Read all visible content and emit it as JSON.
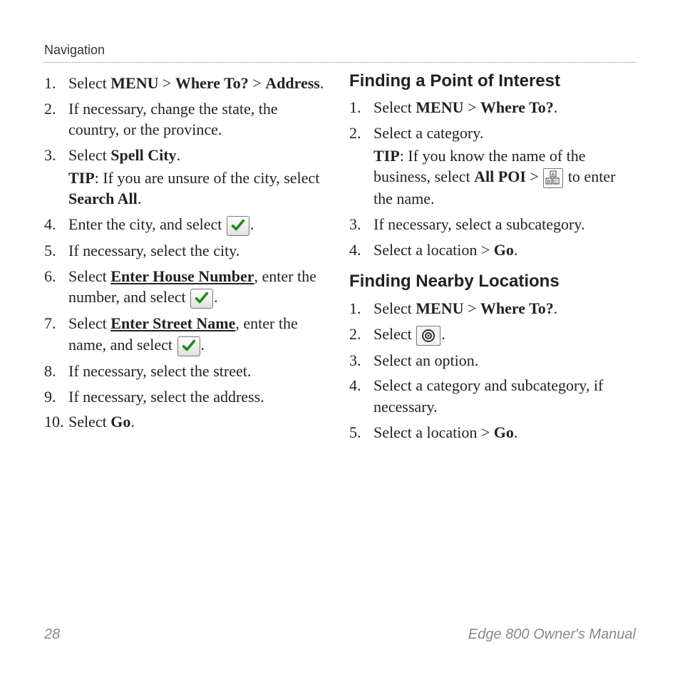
{
  "header": "Navigation",
  "footer": {
    "page": "28",
    "title": "Edge 800 Owner's Manual"
  },
  "left": {
    "n1": "1.",
    "s1a": "Select ",
    "s1b": "MENU",
    "s1c": " > ",
    "s1d": "Where To?",
    "s1e": " > ",
    "s1f": "Address",
    "s1g": ".",
    "n2": "2.",
    "s2": "If necessary, change the state, the country, or the province.",
    "n3": "3.",
    "s3a": "Select ",
    "s3b": "Spell City",
    "s3c": ".",
    "t3a": "TIP",
    "t3b": ": If you are unsure of the city, select ",
    "t3c": "Search All",
    "t3d": ".",
    "n4": "4.",
    "s4a": "Enter the city, and select ",
    "s4b": ".",
    "n5": "5.",
    "s5": "If necessary, select the city.",
    "n6": "6.",
    "s6a": "Select ",
    "s6b": "Enter House Number",
    "s6c": ", enter the number, and select ",
    "s6d": ".",
    "n7": "7.",
    "s7a": "Select ",
    "s7b": "Enter Street Name",
    "s7c": ", enter the name, and select ",
    "s7d": ".",
    "n8": "8.",
    "s8": "If necessary, select the street.",
    "n9": "9.",
    "s9": "If necessary, select the address.",
    "n10": "10.",
    "s10a": "Select ",
    "s10b": "Go",
    "s10c": "."
  },
  "poi": {
    "title": "Finding a Point of Interest",
    "n1": "1.",
    "s1a": "Select ",
    "s1b": "MENU",
    "s1c": " > ",
    "s1d": "Where To?",
    "s1e": ".",
    "n2": "2.",
    "s2": "Select a category.",
    "t2a": "TIP",
    "t2b": ": If you know the name of the business, select ",
    "t2c": "All POI",
    "t2d": " > ",
    "t2e": " to enter the name.",
    "n3": "3.",
    "s3": "If necessary, select a subcategory.",
    "n4": "4.",
    "s4a": "Select a location > ",
    "s4b": "Go",
    "s4c": "."
  },
  "near": {
    "title": "Finding Nearby Locations",
    "n1": "1.",
    "s1a": "Select ",
    "s1b": "MENU",
    "s1c": " > ",
    "s1d": "Where To?",
    "s1e": ".",
    "n2": "2.",
    "s2a": "Select ",
    "s2b": ".",
    "n3": "3.",
    "s3": "Select an option.",
    "n4": "4.",
    "s4": "Select a category and subcategory, if necessary.",
    "n5": "5.",
    "s5a": "Select a location > ",
    "s5b": "Go",
    "s5c": "."
  }
}
